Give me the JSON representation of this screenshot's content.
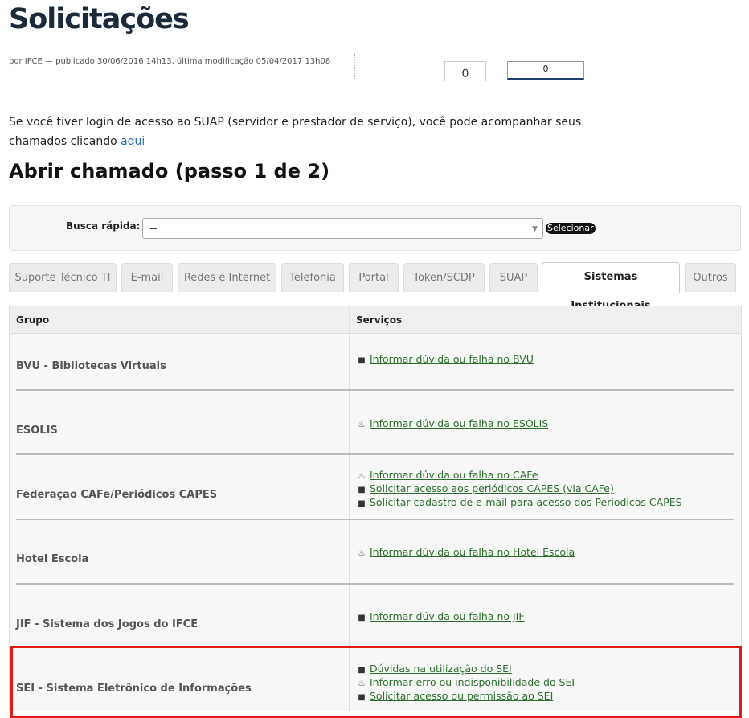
{
  "page": {
    "title": "Solicitações",
    "byline": "por IFCE — publicado 30/06/2016 14h13, última modificação 05/04/2017 13h08",
    "counter_1": "0",
    "counter_2": "0"
  },
  "intro": {
    "text": "Se você tiver login de acesso ao SUAP (servidor e prestador de serviço), você pode acompanhar seus chamados clicando ",
    "link_label": "aqui"
  },
  "section": {
    "title": "Abrir chamado (passo 1 de 2)"
  },
  "search": {
    "label": "Busca rápida:",
    "required_mark": "*",
    "selected_value": "--",
    "button_label": "Selecionar"
  },
  "tabs": [
    {
      "label": "Suporte Técnico TI"
    },
    {
      "label": "E-mail"
    },
    {
      "label": "Redes e Internet"
    },
    {
      "label": "Telefonia"
    },
    {
      "label": "Portal"
    },
    {
      "label": "Token/SCDP"
    },
    {
      "label": "SUAP"
    },
    {
      "label": "Sistemas Institucionais",
      "active": true
    },
    {
      "label": "Outros"
    }
  ],
  "table": {
    "headers": {
      "group": "Grupo",
      "services": "Serviços"
    },
    "rows": [
      {
        "group": "BVU - Bibliotecas Virtuais",
        "services": [
          {
            "icon": "comment-icon",
            "label": "Informar dúvida ou falha no BVU"
          }
        ]
      },
      {
        "group": "ESOLIS",
        "services": [
          {
            "icon": "fire-icon",
            "label": "Informar dúvida ou falha no ESOLIS"
          }
        ]
      },
      {
        "group": "Federação CAFe/Periódicos CAPES",
        "services": [
          {
            "icon": "fire-icon",
            "label": "Informar dúvida ou falha no CAFe"
          },
          {
            "icon": "comment-icon",
            "label": "Solicitar acesso aos periódicos CAPES (via CAFe)"
          },
          {
            "icon": "comment-icon",
            "label": "Solicitar cadastro de e-mail para acesso dos Periodicos CAPES"
          }
        ]
      },
      {
        "group": "Hotel Escola",
        "services": [
          {
            "icon": "fire-icon",
            "label": "Informar dúvida ou falha no Hotel Escola"
          }
        ]
      },
      {
        "group": "JIF - Sistema dos Jogos do IFCE",
        "services": [
          {
            "icon": "comment-icon",
            "label": "Informar dúvida ou falha no JIF"
          }
        ]
      },
      {
        "group": "SEI - Sistema Eletrônico de Informações",
        "services": [
          {
            "icon": "comment-icon",
            "label": "Dúvidas na utilização do SEI"
          },
          {
            "icon": "fire-icon",
            "label": "Informar erro ou indisponibilidade do SEI"
          },
          {
            "icon": "comment-icon",
            "label": "Solicitar acesso ou permissão ao SEI"
          }
        ]
      }
    ]
  },
  "colors": {
    "link": "#2a6bb3",
    "service_link": "#2e6f2e",
    "highlight": "#e01b1b"
  }
}
